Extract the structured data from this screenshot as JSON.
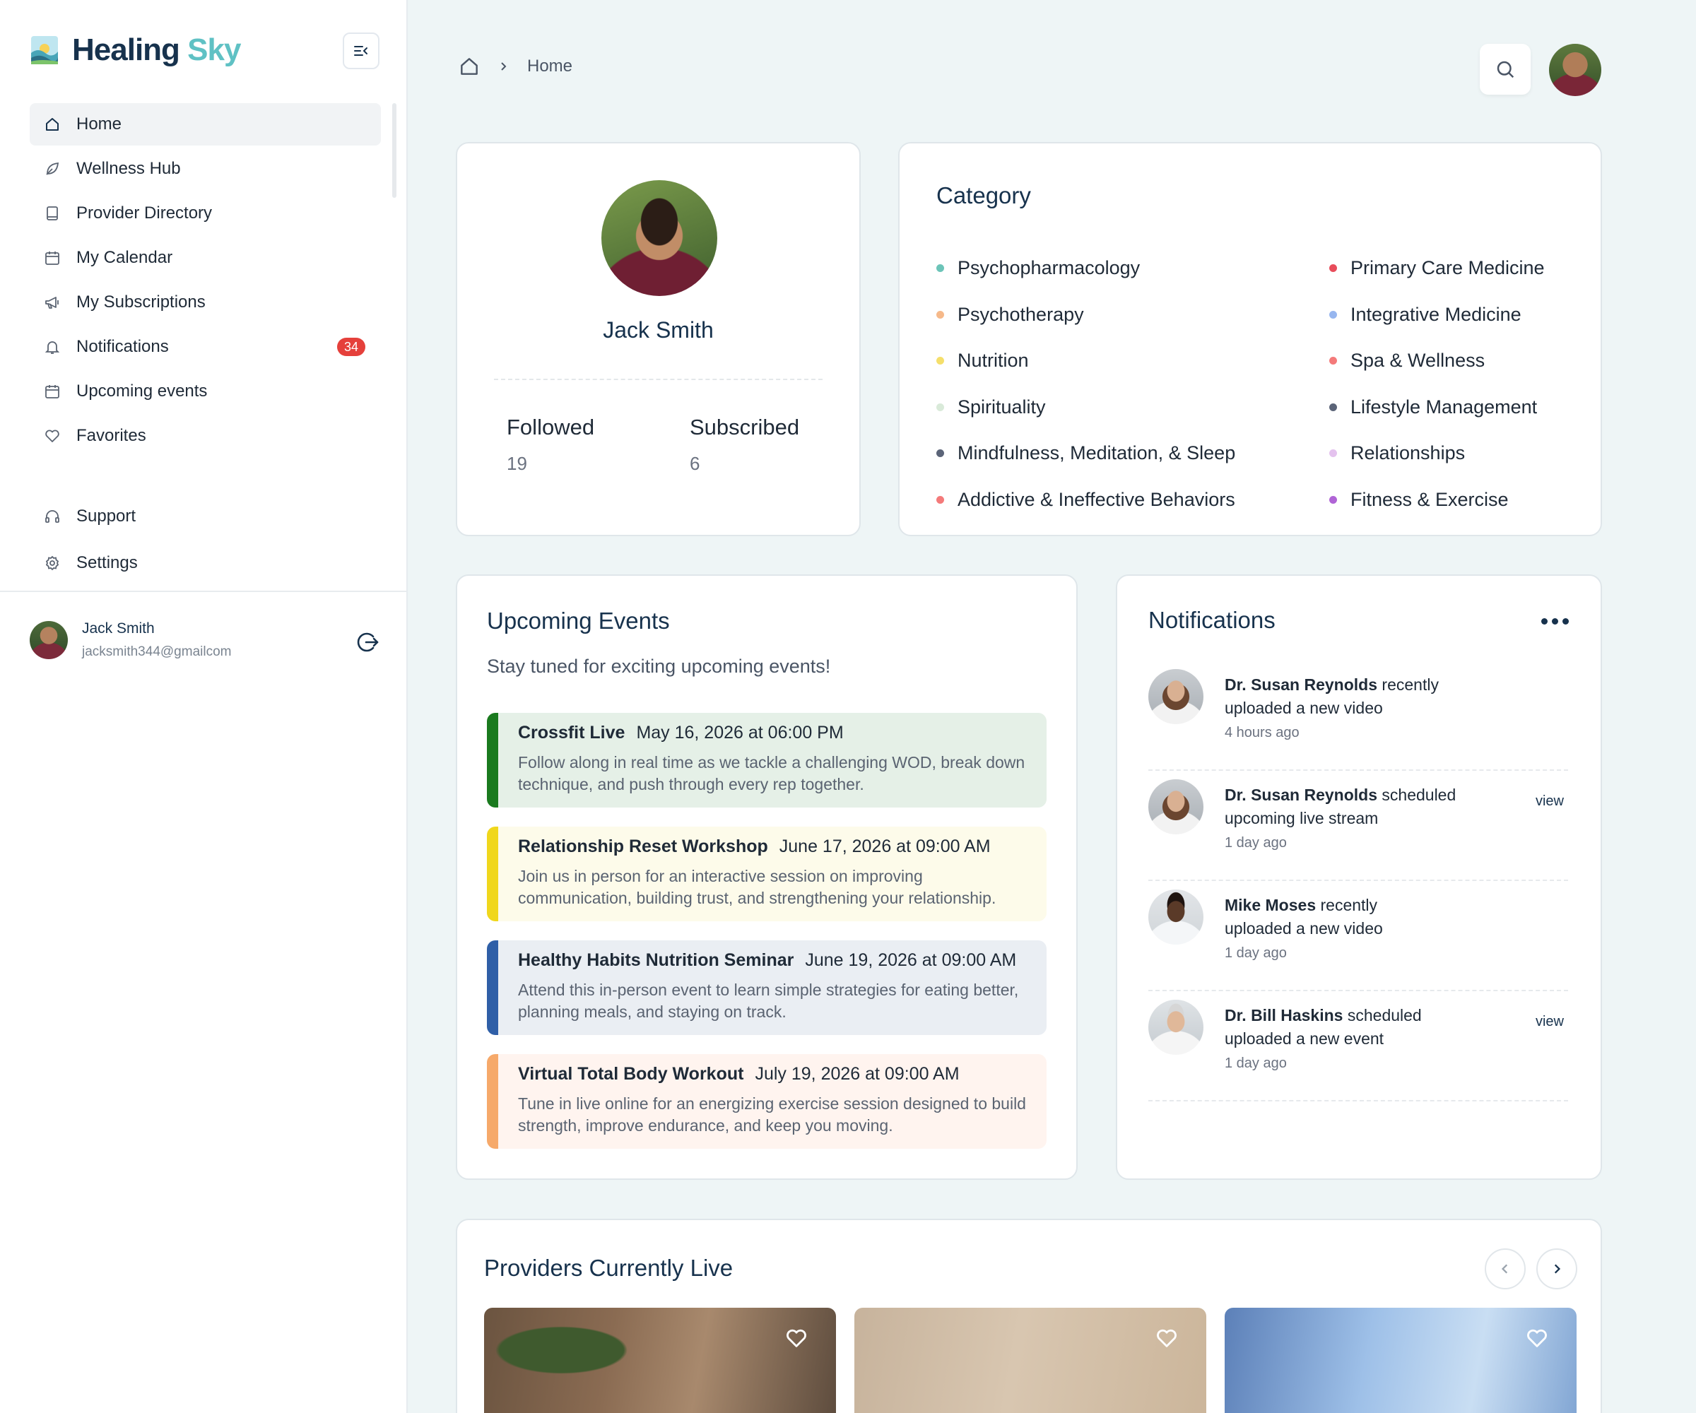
{
  "brand": {
    "name_part1": "Healing",
    "name_part2": "Sky"
  },
  "sidebar": {
    "items": [
      {
        "label": "Home",
        "icon": "home-icon",
        "active": true
      },
      {
        "label": "Wellness Hub",
        "icon": "leaf-icon"
      },
      {
        "label": "Provider Directory",
        "icon": "book-icon"
      },
      {
        "label": "My Calendar",
        "icon": "calendar-icon"
      },
      {
        "label": "My Subscriptions",
        "icon": "megaphone-icon"
      },
      {
        "label": "Notifications",
        "icon": "bell-icon",
        "badge": "34"
      },
      {
        "label": "Upcoming events",
        "icon": "calendar-icon"
      },
      {
        "label": "Favorites",
        "icon": "heart-icon"
      }
    ],
    "bottom_items": [
      {
        "label": "Support",
        "icon": "headphones-icon"
      },
      {
        "label": "Settings",
        "icon": "gear-icon"
      }
    ],
    "user": {
      "name": "Jack Smith",
      "email": "jacksmith344@gmailcom"
    }
  },
  "breadcrumb": {
    "current": "Home"
  },
  "profile": {
    "name": "Jack Smith",
    "stats": [
      {
        "label": "Followed",
        "value": "19"
      },
      {
        "label": "Subscribed",
        "value": "6"
      }
    ]
  },
  "category": {
    "title": "Category",
    "left": [
      {
        "label": "Psychopharmacology",
        "color": "#6cc4b8"
      },
      {
        "label": "Psychotherapy",
        "color": "#f6b98a"
      },
      {
        "label": "Nutrition",
        "color": "#f5df6b"
      },
      {
        "label": "Spirituality",
        "color": "#d9ead9"
      },
      {
        "label": "Mindfulness, Meditation, & Sleep",
        "color": "#5b6478"
      },
      {
        "label": "Addictive & Ineffective Behaviors",
        "color": "#f47a7a"
      }
    ],
    "right": [
      {
        "label": "Primary Care Medicine",
        "color": "#e84d5b"
      },
      {
        "label": "Integrative Medicine",
        "color": "#97b6ef"
      },
      {
        "label": "Spa & Wellness",
        "color": "#f47a7a"
      },
      {
        "label": "Lifestyle Management",
        "color": "#5b6478"
      },
      {
        "label": "Relationships",
        "color": "#e4c2ee"
      },
      {
        "label": "Fitness & Exercise",
        "color": "#b064d6"
      }
    ]
  },
  "events": {
    "title": "Upcoming Events",
    "subtitle": "Stay tuned for exciting upcoming events!",
    "items": [
      {
        "title": "Crossfit Live",
        "date": "May 16, 2026 at 06:00 PM",
        "desc": "Follow along in real time as we tackle a challenging WOD, break down technique, and push through every rep together.",
        "bar": "#1a7a1e",
        "bg": "#e5f0e7"
      },
      {
        "title": "Relationship Reset Workshop",
        "date": "June 17, 2026 at 09:00 AM",
        "desc": "Join us in person for an interactive session on improving communication, building trust, and strengthening your relationship.",
        "bar": "#f0d71c",
        "bg": "#fdfbea"
      },
      {
        "title": "Healthy Habits Nutrition Seminar",
        "date": "June 19, 2026 at 09:00 AM",
        "desc": "Attend this in-person event to learn simple strategies for eating better, planning meals, and staying on track.",
        "bar": "#2f5fa7",
        "bg": "#eaeef3"
      },
      {
        "title": "Virtual Total Body Workout",
        "date": "July 19, 2026 at 09:00 AM",
        "desc": "Tune in live online for an energizing exercise session designed to build strength, improve endurance, and keep you moving.",
        "bar": "#f6a96a",
        "bg": "#fff4ef"
      }
    ]
  },
  "notifications": {
    "title": "Notifications",
    "items": [
      {
        "name": "Dr. Susan Reynolds",
        "text_a": " recently",
        "text_b": "uploaded a new video",
        "time": "4 hours ago",
        "view": ""
      },
      {
        "name": "Dr. Susan Reynolds",
        "text_a": " scheduled",
        "text_b": "upcoming live stream",
        "time": "1 day ago",
        "view": "view"
      },
      {
        "name": "Mike Moses",
        "text_a": " recently",
        "text_b": "uploaded a new video",
        "time": "1 day ago",
        "view": ""
      },
      {
        "name": "Dr. Bill Haskins",
        "text_a": " scheduled",
        "text_b": "uploaded a new event",
        "time": "1 day ago",
        "view": "view"
      }
    ]
  },
  "providers": {
    "title": "Providers Currently Live"
  }
}
